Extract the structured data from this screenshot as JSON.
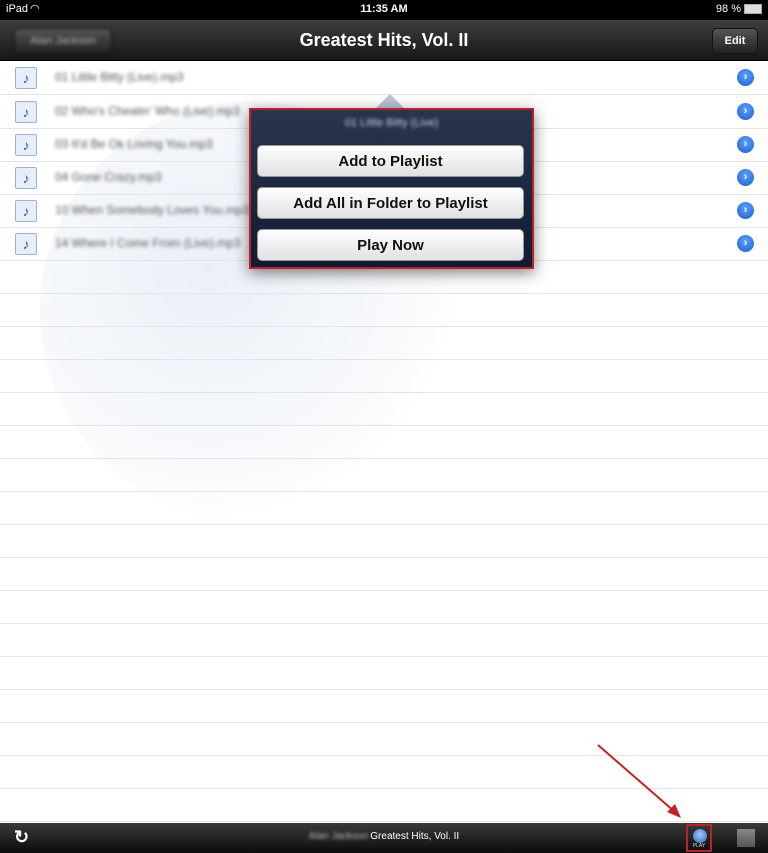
{
  "status_bar": {
    "device": "iPad",
    "time": "11:35 AM",
    "battery": "98 %"
  },
  "nav": {
    "back_label": "Alan Jackson",
    "title": "Greatest Hits, Vol. II",
    "edit_label": "Edit"
  },
  "songs": [
    {
      "title": "01 Little Bitty (Live).mp3"
    },
    {
      "title": "02 Who's Cheatin' Who (Live).mp3"
    },
    {
      "title": "03 It'd Be Ok Loving You.mp3"
    },
    {
      "title": "04 Gone Crazy.mp3"
    },
    {
      "title": "10 When Somebody Loves You.mp3"
    },
    {
      "title": "14 Where I Come From (Live).mp3"
    }
  ],
  "popover": {
    "header": "01 Little Bitty (Live)",
    "add_to_playlist": "Add to Playlist",
    "add_all_in_folder": "Add All in Folder to Playlist",
    "play_now": "Play Now"
  },
  "toolbar": {
    "artist": "Alan Jackson",
    "now_playing": "Greatest Hits, Vol. II",
    "play_icon_label": "PLAY"
  },
  "icons": {
    "song": "music-note-icon",
    "detail": "disclosure-icon",
    "refresh": "refresh-icon",
    "play": "play-list-icon",
    "stop": "stop-icon"
  }
}
